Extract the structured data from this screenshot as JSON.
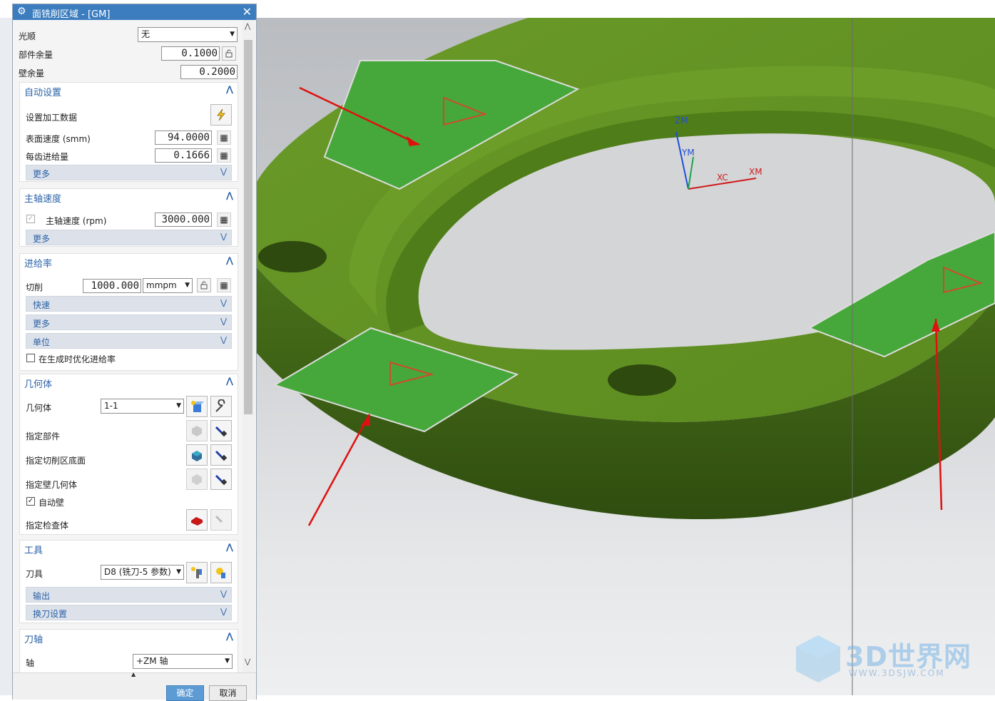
{
  "dialog": {
    "title": "面铣削区域 - [GM]",
    "smooth": {
      "label": "光顺",
      "value": "无"
    },
    "part_stock": {
      "label": "部件余量",
      "value": "0.1000"
    },
    "wall_stock": {
      "label": "壁余量",
      "value": "0.2000"
    },
    "auto_settings": {
      "header": "自动设置",
      "set_machining_data": "设置加工数据",
      "surface_speed": {
        "label": "表面速度 (smm)",
        "value": "94.0000"
      },
      "feed_per_tooth": {
        "label": "每齿进给量",
        "value": "0.1666"
      },
      "more": "更多"
    },
    "spindle": {
      "header": "主轴速度",
      "spindle_speed": {
        "label": "主轴速度 (rpm)",
        "value": "3000.000"
      },
      "more": "更多"
    },
    "feed": {
      "header": "进给率",
      "cut": {
        "label": "切削",
        "value": "1000.000",
        "unit": "mmpm"
      },
      "rapid": "快速",
      "more": "更多",
      "units": "单位",
      "optimize": "在生成时优化进给率"
    },
    "geometry": {
      "header": "几何体",
      "geom": {
        "label": "几何体",
        "value": "1-1"
      },
      "specify_part": "指定部件",
      "specify_floor": "指定切削区底面",
      "specify_wall": "指定壁几何体",
      "auto_wall": "自动壁",
      "specify_check": "指定检查体"
    },
    "tool": {
      "header": "工具",
      "tool": {
        "label": "刀具",
        "value": "D8 (铣刀-5 参数)"
      },
      "output": "输出",
      "tool_change": "换刀设置"
    },
    "tool_axis": {
      "header": "刀轴",
      "axis": {
        "label": "轴",
        "value": "+ZM 轴"
      }
    },
    "ok": "确定",
    "cancel": "取消"
  },
  "viewport": {
    "axes": {
      "zm": "ZM",
      "ym": "YM",
      "xc": "XC",
      "xm": "XM"
    },
    "colors": {
      "part": "#5a8a1f",
      "face": "#45a83a",
      "arrow": "#e01010"
    }
  },
  "watermark": {
    "text": "3D世界网",
    "url": "WWW.3DSJW.COM"
  }
}
